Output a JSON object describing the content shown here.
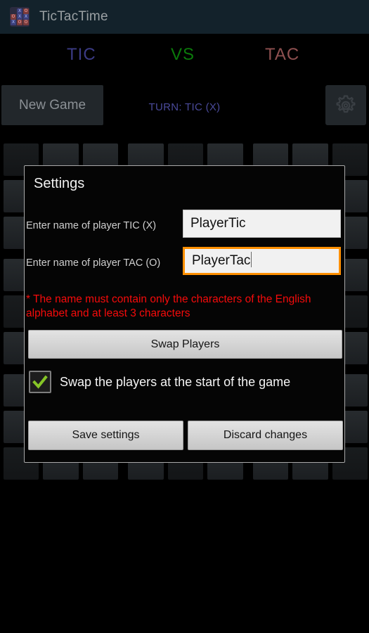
{
  "titlebar": {
    "app_name": "TicTacTime",
    "icon": "tictactoe-grid-icon",
    "bg": "#13222b",
    "icon_cells": [
      {
        "mark": "",
        "color": "none"
      },
      {
        "mark": "X",
        "color": "blue"
      },
      {
        "mark": "O",
        "color": "red"
      },
      {
        "mark": "O",
        "color": "red"
      },
      {
        "mark": "X",
        "color": "blue"
      },
      {
        "mark": "X",
        "color": "blue"
      },
      {
        "mark": "X",
        "color": "blue"
      },
      {
        "mark": "O",
        "color": "red"
      },
      {
        "mark": "O",
        "color": "red"
      }
    ]
  },
  "players": {
    "tic": "TIC",
    "vs": "VS",
    "tac": "TAC",
    "tic_color": "#3b3b85",
    "vs_color": "#0b7a0b",
    "tac_color": "#8f5050"
  },
  "toolbar": {
    "new_game_label": "New Game",
    "turn_text": "TURN: TIC (X)",
    "turn_color": "#4a4a9a",
    "settings_icon": "gear-icon"
  },
  "board": {
    "blocks": 9,
    "cells_per_block": 9,
    "marks": []
  },
  "dialog": {
    "title": "Settings",
    "label_tic": "Enter name of player TIC (X)",
    "label_tac": "Enter name of player TAC (O)",
    "input_tic_value": "PlayerTic",
    "input_tic_placeholder": "",
    "input_tac_value": "PlayerTac",
    "input_tac_placeholder": "",
    "input_tac_focused": true,
    "focus_color": "#ff8f00",
    "hint_text": "* The name must contain only the characters of the English alphabet and at least 3 characters",
    "hint_color": "#f60b0b",
    "swap_players_label": "Swap Players",
    "swap_checkbox_label": "Swap the players at the start of the game",
    "swap_checkbox_checked": true,
    "checkmark_color": "#86c527",
    "save_label": "Save settings",
    "discard_label": "Discard changes"
  }
}
